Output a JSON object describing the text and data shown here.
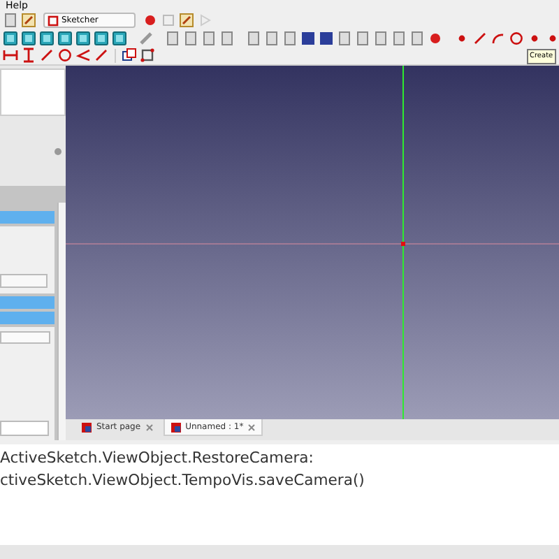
{
  "menu_bar": {
    "items": [
      {
        "label": "Help"
      }
    ]
  },
  "toolbar": {
    "workbench": "Sketcher"
  },
  "tooltip": {
    "text": "Create"
  },
  "tabs": [
    {
      "label": "Start page",
      "selected": false
    },
    {
      "label": "Unnamed : 1*",
      "selected": true
    }
  ],
  "python_console": {
    "lines": [
      "ActiveSketch.ViewObject.RestoreCamera:",
      "ctiveSketch.ViewObject.TempoVis.saveCamera()"
    ]
  }
}
